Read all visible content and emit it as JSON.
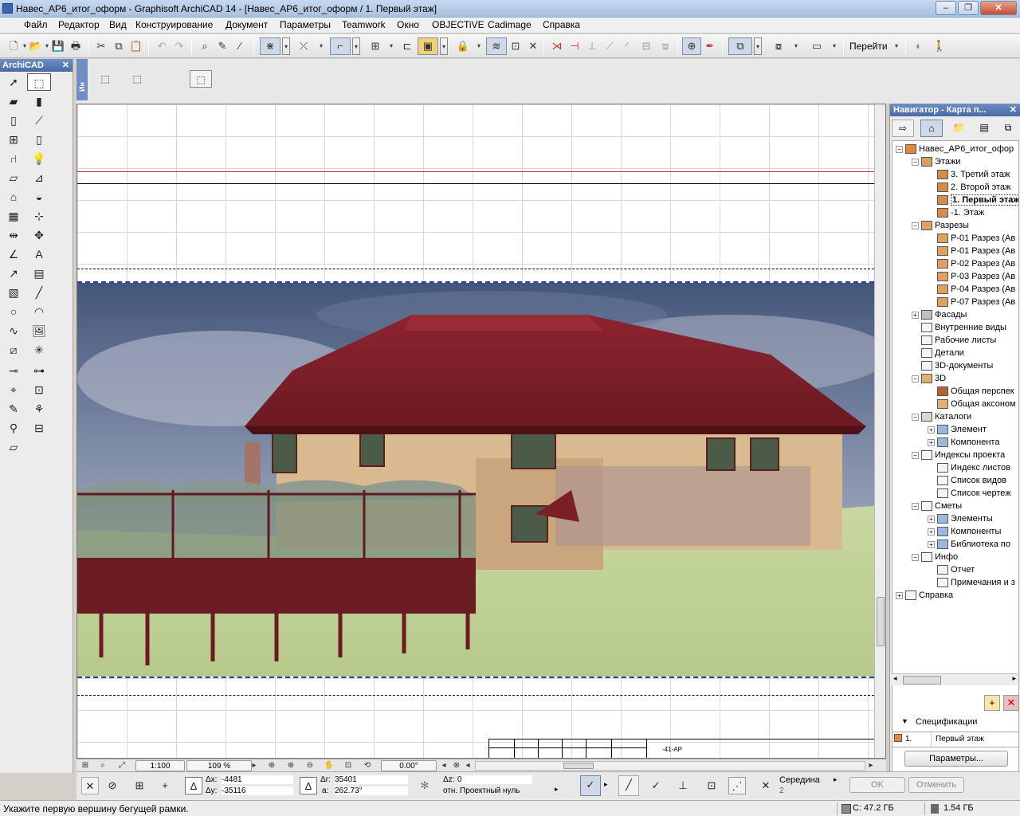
{
  "window": {
    "title": "Навес_АР6_итог_оформ - Graphisoft ArchiCAD 14 - [Навес_АР6_итог_оформ / 1. Первый этаж]",
    "controls": [
      "–",
      "❐",
      "✕"
    ]
  },
  "menu": [
    "Файл",
    "Редактор",
    "Вид",
    "Конструирование",
    "Документ",
    "Параметры",
    "Teamwork",
    "Окно",
    "OBJECTiVE",
    "Cadimage",
    "Справка"
  ],
  "toolbar": {
    "goto_label": "Перейти"
  },
  "toolbox": {
    "title": "ArchiCAD",
    "close": "✕"
  },
  "infobox": {
    "side_label": "Ин"
  },
  "canvas": {
    "titleblock_code": "-41-АР"
  },
  "navbar": {
    "scale": "1:100",
    "zoom": "109 %",
    "angle": "0.00°"
  },
  "navigator": {
    "title": "Навигатор - Карта п...",
    "close": "✕",
    "tree": [
      {
        "label": "Навес_АР6_итог_офор",
        "level": 0,
        "exp": "−",
        "icon": "house"
      },
      {
        "label": "Этажи",
        "level": 1,
        "exp": "−",
        "icon": "stack"
      },
      {
        "label": "3. Третий этаж",
        "level": 2,
        "icon": "story"
      },
      {
        "label": "2. Второй этаж",
        "level": 2,
        "icon": "story"
      },
      {
        "label": "1. Первый этаж",
        "level": 2,
        "icon": "story",
        "selected": true
      },
      {
        "label": "-1. Этаж",
        "level": 2,
        "icon": "story"
      },
      {
        "label": "Разрезы",
        "level": 1,
        "exp": "−",
        "icon": "section"
      },
      {
        "label": "Р-01 Разрез (Ав",
        "level": 2,
        "icon": "section"
      },
      {
        "label": "Р-01 Разрез (Ав",
        "level": 2,
        "icon": "section"
      },
      {
        "label": "Р-02 Разрез (Ав",
        "level": 2,
        "icon": "section"
      },
      {
        "label": "Р-03 Разрез (Ав",
        "level": 2,
        "icon": "section"
      },
      {
        "label": "Р-04 Разрез (Ав",
        "level": 2,
        "icon": "section"
      },
      {
        "label": "Р-07 Разрез (Ав",
        "level": 2,
        "icon": "section"
      },
      {
        "label": "Фасады",
        "level": 1,
        "exp": "+",
        "icon": "elevation"
      },
      {
        "label": "Внутренние виды",
        "level": 1,
        "icon": "doc"
      },
      {
        "label": "Рабочие листы",
        "level": 1,
        "icon": "doc"
      },
      {
        "label": "Детали",
        "level": 1,
        "icon": "doc"
      },
      {
        "label": "3D-документы",
        "level": 1,
        "icon": "doc"
      },
      {
        "label": "3D",
        "level": 1,
        "exp": "−",
        "icon": "cube"
      },
      {
        "label": "Общая перспек",
        "level": 2,
        "icon": "camera"
      },
      {
        "label": "Общая аксоном",
        "level": 2,
        "icon": "cube"
      },
      {
        "label": "Каталоги",
        "level": 1,
        "exp": "−",
        "icon": "table"
      },
      {
        "label": "Элемент",
        "level": 2,
        "exp": "+",
        "icon": "list"
      },
      {
        "label": "Компонента",
        "level": 2,
        "exp": "+",
        "icon": "list"
      },
      {
        "label": "Индексы проекта",
        "level": 1,
        "exp": "−",
        "icon": "doc"
      },
      {
        "label": "Индекс листов",
        "level": 2,
        "icon": "doc"
      },
      {
        "label": "Список видов",
        "level": 2,
        "icon": "doc"
      },
      {
        "label": "Список чертеж",
        "level": 2,
        "icon": "doc"
      },
      {
        "label": "Сметы",
        "level": 1,
        "exp": "−",
        "icon": "doc"
      },
      {
        "label": "Элементы",
        "level": 2,
        "exp": "+",
        "icon": "list"
      },
      {
        "label": "Компоненты",
        "level": 2,
        "exp": "+",
        "icon": "list"
      },
      {
        "label": "Библиотека по",
        "level": 2,
        "exp": "+",
        "icon": "list"
      },
      {
        "label": "Инфо",
        "level": 1,
        "exp": "−",
        "icon": "doc"
      },
      {
        "label": "Отчет",
        "level": 2,
        "icon": "doc"
      },
      {
        "label": "Примечания и з",
        "level": 2,
        "icon": "doc"
      },
      {
        "label": "Справка",
        "level": 0,
        "exp": "+",
        "icon": "doc"
      }
    ],
    "spec_label": "Спецификации",
    "spec_id": "1.",
    "spec_name": "Первый этаж",
    "params_button": "Параметры..."
  },
  "coords": {
    "dx_label": "Δx:",
    "dx": "-4481",
    "dy_label": "Δy:",
    "dy": "-35116",
    "dr_label": "Δr:",
    "dr": "35401",
    "a_label": "a:",
    "a": "262.73°",
    "dz_label": "Δz:",
    "dz": "0",
    "ref": "отн. Проектный нуль",
    "snap_label": "Середина",
    "snap_count": "2",
    "ok": "OK",
    "cancel": "Отменить"
  },
  "status": {
    "message": "Укажите первую вершину бегущей рамки.",
    "disk_c": "C: 47.2 ГБ",
    "memory": "1.54 ГБ"
  },
  "colors": {
    "header_blue": "#4a6aa6",
    "roof_red": "#7a1f26",
    "selection_blue": "#2a3aa8"
  }
}
